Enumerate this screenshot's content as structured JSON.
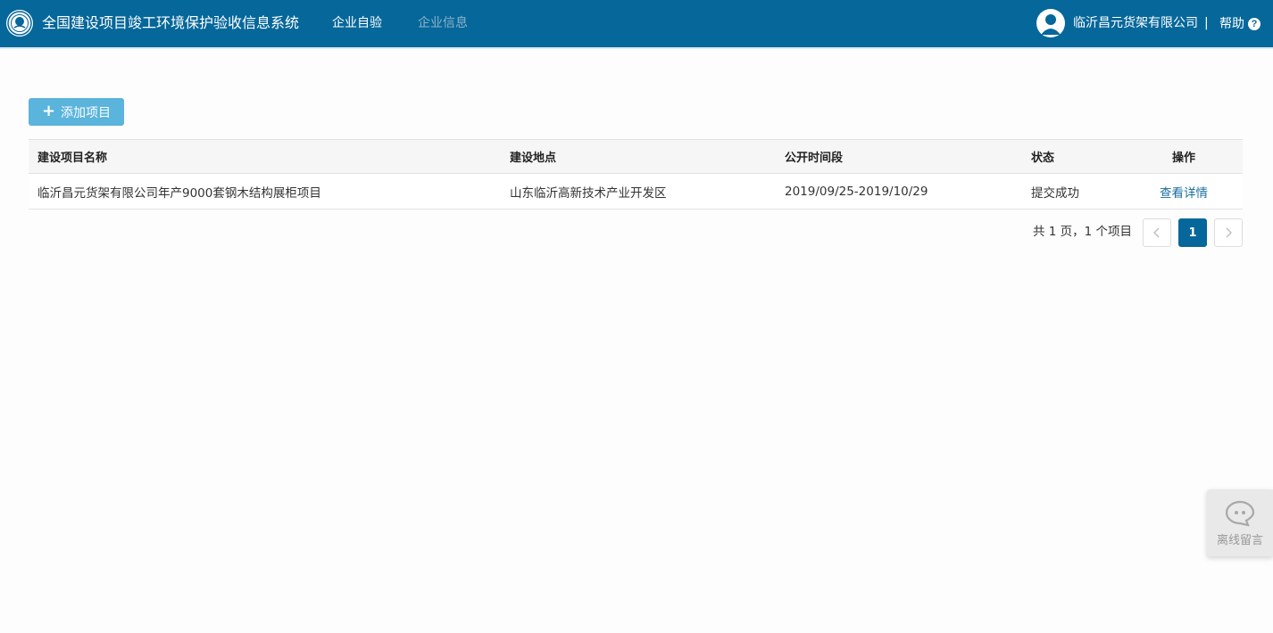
{
  "header": {
    "system_title": "全国建设项目竣工环境保护验收信息系统",
    "nav": [
      {
        "label": "企业自验",
        "active": true
      },
      {
        "label": "企业信息",
        "active": false
      }
    ],
    "company_name": "临沂昌元货架有限公司",
    "separator": "|",
    "help_label": "帮助",
    "help_icon_glyph": "?",
    "accent_color": "#05679a"
  },
  "toolbar": {
    "add_button_icon": "+",
    "add_button_label": "添加项目"
  },
  "table": {
    "columns": [
      "建设项目名称",
      "建设地点",
      "公开时间段",
      "状态",
      "操作"
    ],
    "rows": [
      {
        "name": "临沂昌元货架有限公司年产9000套钢木结构展柜项目",
        "location": "山东临沂高新技术产业开发区",
        "period": "2019/09/25-2019/10/29",
        "status": "提交成功",
        "action": "查看详情"
      }
    ]
  },
  "pagination": {
    "summary": "共 1 页，1 个项目",
    "current_page": "1"
  },
  "chat_widget": {
    "label": "离线留言"
  }
}
